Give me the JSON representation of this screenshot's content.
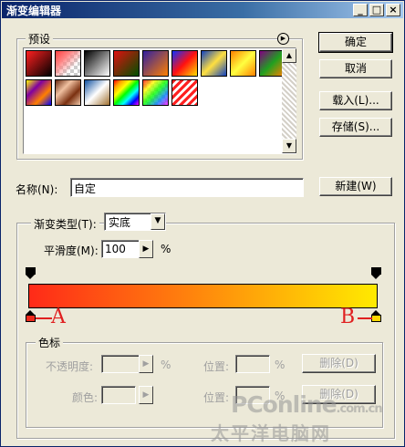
{
  "window": {
    "title": "渐变编辑器",
    "buttons": [
      "_",
      "□",
      "×"
    ]
  },
  "presets": {
    "label": "预设",
    "menu_icon": "circle-right-arrow-icon",
    "tiles": [
      {
        "name": "red-to-black",
        "bg": "linear-gradient(135deg,#ff2020,#000)"
      },
      {
        "name": "red-to-transparent",
        "bg": "linear-gradient(135deg,#ff4040 0%,#ff8080 30%,transparent 70%),repeating-conic-gradient(#ccc 0 25%,#fff 0 50%) 0 0/8px 8px"
      },
      {
        "name": "black-to-white",
        "bg": "linear-gradient(135deg,#000,#fff)"
      },
      {
        "name": "red-to-green",
        "bg": "linear-gradient(135deg,#e01010,#005000)"
      },
      {
        "name": "violet-to-orange",
        "bg": "linear-gradient(135deg,#3020a0,#ff8000)"
      },
      {
        "name": "blue-red-yellow",
        "bg": "linear-gradient(135deg,#1030ff,#ff1010,#ffe000)"
      },
      {
        "name": "blue-yellow-blue",
        "bg": "linear-gradient(135deg,#1040c0 0%,#ffe040 50%,#1040c0 100%)"
      },
      {
        "name": "orange-yellow-orange",
        "bg": "linear-gradient(135deg,#ff8000 0%,#ffff40 50%,#ff8000 100%)"
      },
      {
        "name": "violet-green-orange",
        "bg": "linear-gradient(135deg,#800080,#20a020,#ff8000)"
      },
      {
        "name": "yellow-violet-orange-blue",
        "bg": "linear-gradient(135deg,#ffff00,#8000a0,#ff8000,#0000ff)"
      },
      {
        "name": "copper",
        "bg": "linear-gradient(135deg,#6a2a10,#f0c0a0,#7a3010,#f0c8a8)"
      },
      {
        "name": "chrome",
        "bg": "linear-gradient(135deg,#1050a0,#fff 50%,#a07030)"
      },
      {
        "name": "spectrum",
        "bg": "linear-gradient(135deg,red,orange,yellow,lime,cyan,blue,magenta)"
      },
      {
        "name": "transparent-rainbow",
        "bg": "linear-gradient(135deg,rgba(255,0,0,.8),rgba(255,255,0,.8),rgba(0,255,0,.8),rgba(0,128,255,.8),rgba(255,0,255,.8)),repeating-conic-gradient(#ccc 0 25%,#fff 0 50%) 0 0/8px 8px"
      },
      {
        "name": "transparent-stripes",
        "bg": "repeating-linear-gradient(135deg,#ff2020 0 3px,#fff 3px 6px)"
      }
    ]
  },
  "buttons": {
    "ok": "确定",
    "cancel": "取消",
    "load": "载入(L)...",
    "save": "存储(S)...",
    "new": "新建(W)"
  },
  "name_field": {
    "label": "名称(N):",
    "value": "自定"
  },
  "gradient": {
    "type_label": "渐变类型(T):",
    "type_value": "实底",
    "smoothness_label": "平滑度(M):",
    "smoothness_value": "100",
    "smoothness_unit": "%",
    "bar_colors": [
      "#ff2a18",
      "#ffea00"
    ],
    "stops": [
      {
        "position": 0,
        "color": "#ee2a1c"
      },
      {
        "position": 100,
        "color": "#ffd800"
      }
    ],
    "annotations": [
      "A",
      "B"
    ],
    "annotation_color": "#e02020"
  },
  "color_stops": {
    "label": "色标",
    "opacity_label": "不透明度:",
    "opacity_unit": "%",
    "color_label": "颜色:",
    "position_label": "位置:",
    "position_unit": "%",
    "delete_label": "删除(D)"
  },
  "watermark": {
    "line1": "PConline",
    "line2": "太平洋电脑网",
    "suffix": ".com.cn"
  }
}
